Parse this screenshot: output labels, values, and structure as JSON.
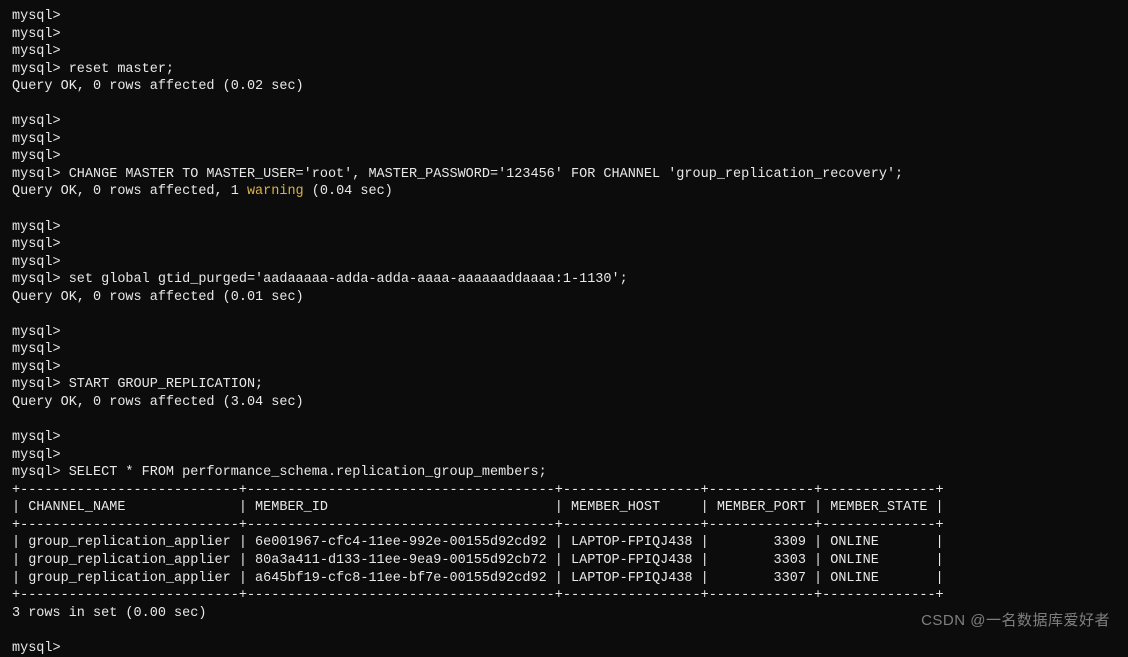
{
  "prompts": {
    "empty": "mysql>",
    "cmd_reset_master": "mysql> reset master;",
    "result_reset_master": "Query OK, 0 rows affected (0.02 sec)",
    "cmd_change_master": "mysql> CHANGE MASTER TO MASTER_USER='root', MASTER_PASSWORD='123456' FOR CHANNEL 'group_replication_recovery';",
    "result_change_master_a": "Query OK, 0 rows affected, 1 ",
    "result_change_master_warn": "warning",
    "result_change_master_b": " (0.04 sec)",
    "cmd_set_gtid": "mysql> set global gtid_purged='aadaaaaa-adda-adda-aaaa-aaaaaaddaaaa:1-1130';",
    "result_set_gtid": "Query OK, 0 rows affected (0.01 sec)",
    "cmd_start_gr": "mysql> START GROUP_REPLICATION;",
    "result_start_gr": "Query OK, 0 rows affected (3.04 sec)",
    "cmd_select": "mysql> SELECT * FROM performance_schema.replication_group_members;"
  },
  "table": {
    "sep": "+---------------------------+--------------------------------------+-----------------+-------------+--------------+",
    "header": "| CHANNEL_NAME              | MEMBER_ID                            | MEMBER_HOST     | MEMBER_PORT | MEMBER_STATE |",
    "row1": "| group_replication_applier | 6e001967-cfc4-11ee-992e-00155d92cd92 | LAPTOP-FPIQJ438 |        3309 | ONLINE       |",
    "row2": "| group_replication_applier | 80a3a411-d133-11ee-9ea9-00155d92cb72 | LAPTOP-FPIQJ438 |        3303 | ONLINE       |",
    "row3": "| group_replication_applier | a645bf19-cfc8-11ee-bf7e-00155d92cd92 | LAPTOP-FPIQJ438 |        3307 | ONLINE       |",
    "footer": "3 rows in set (0.00 sec)"
  },
  "watermark": "CSDN @一名数据库爱好者"
}
